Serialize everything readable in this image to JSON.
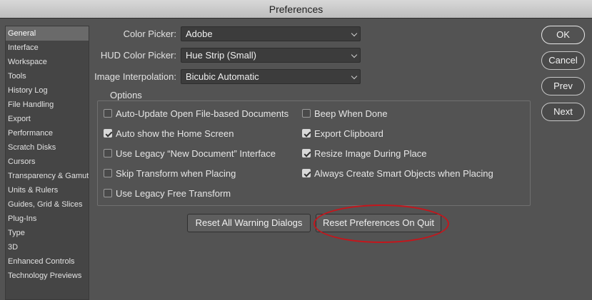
{
  "window": {
    "title": "Preferences"
  },
  "sidebar": {
    "items": [
      {
        "label": "General",
        "selected": true
      },
      {
        "label": "Interface"
      },
      {
        "label": "Workspace"
      },
      {
        "label": "Tools"
      },
      {
        "label": "History Log"
      },
      {
        "label": "File Handling"
      },
      {
        "label": "Export"
      },
      {
        "label": "Performance"
      },
      {
        "label": "Scratch Disks"
      },
      {
        "label": "Cursors"
      },
      {
        "label": "Transparency & Gamut"
      },
      {
        "label": "Units & Rulers"
      },
      {
        "label": "Guides, Grid & Slices"
      },
      {
        "label": "Plug-Ins"
      },
      {
        "label": "Type"
      },
      {
        "label": "3D"
      },
      {
        "label": "Enhanced Controls"
      },
      {
        "label": "Technology Previews"
      }
    ]
  },
  "fields": {
    "color_picker": {
      "label": "Color Picker:",
      "value": "Adobe"
    },
    "hud_color_picker": {
      "label": "HUD Color Picker:",
      "value": "Hue Strip (Small)"
    },
    "image_interpolation": {
      "label": "Image Interpolation:",
      "value": "Bicubic Automatic"
    }
  },
  "options": {
    "title": "Options",
    "left": [
      {
        "label": "Auto-Update Open File-based Documents",
        "checked": false
      },
      {
        "label": "Auto show the Home Screen",
        "checked": true
      },
      {
        "label": "Use Legacy “New Document” Interface",
        "checked": false
      },
      {
        "label": "Skip Transform when Placing",
        "checked": false
      },
      {
        "label": "Use Legacy Free Transform",
        "checked": false
      }
    ],
    "right": [
      {
        "label": "Beep When Done",
        "checked": false
      },
      {
        "label": "Export Clipboard",
        "checked": true
      },
      {
        "label": "Resize Image During Place",
        "checked": true
      },
      {
        "label": "Always Create Smart Objects when Placing",
        "checked": true
      }
    ]
  },
  "buttons": {
    "reset_warnings": "Reset All Warning Dialogs",
    "reset_prefs": "Reset Preferences On Quit",
    "ok": "OK",
    "cancel": "Cancel",
    "prev": "Prev",
    "next": "Next"
  },
  "colors": {
    "highlight": "#c4161c",
    "panel": "#535353"
  }
}
